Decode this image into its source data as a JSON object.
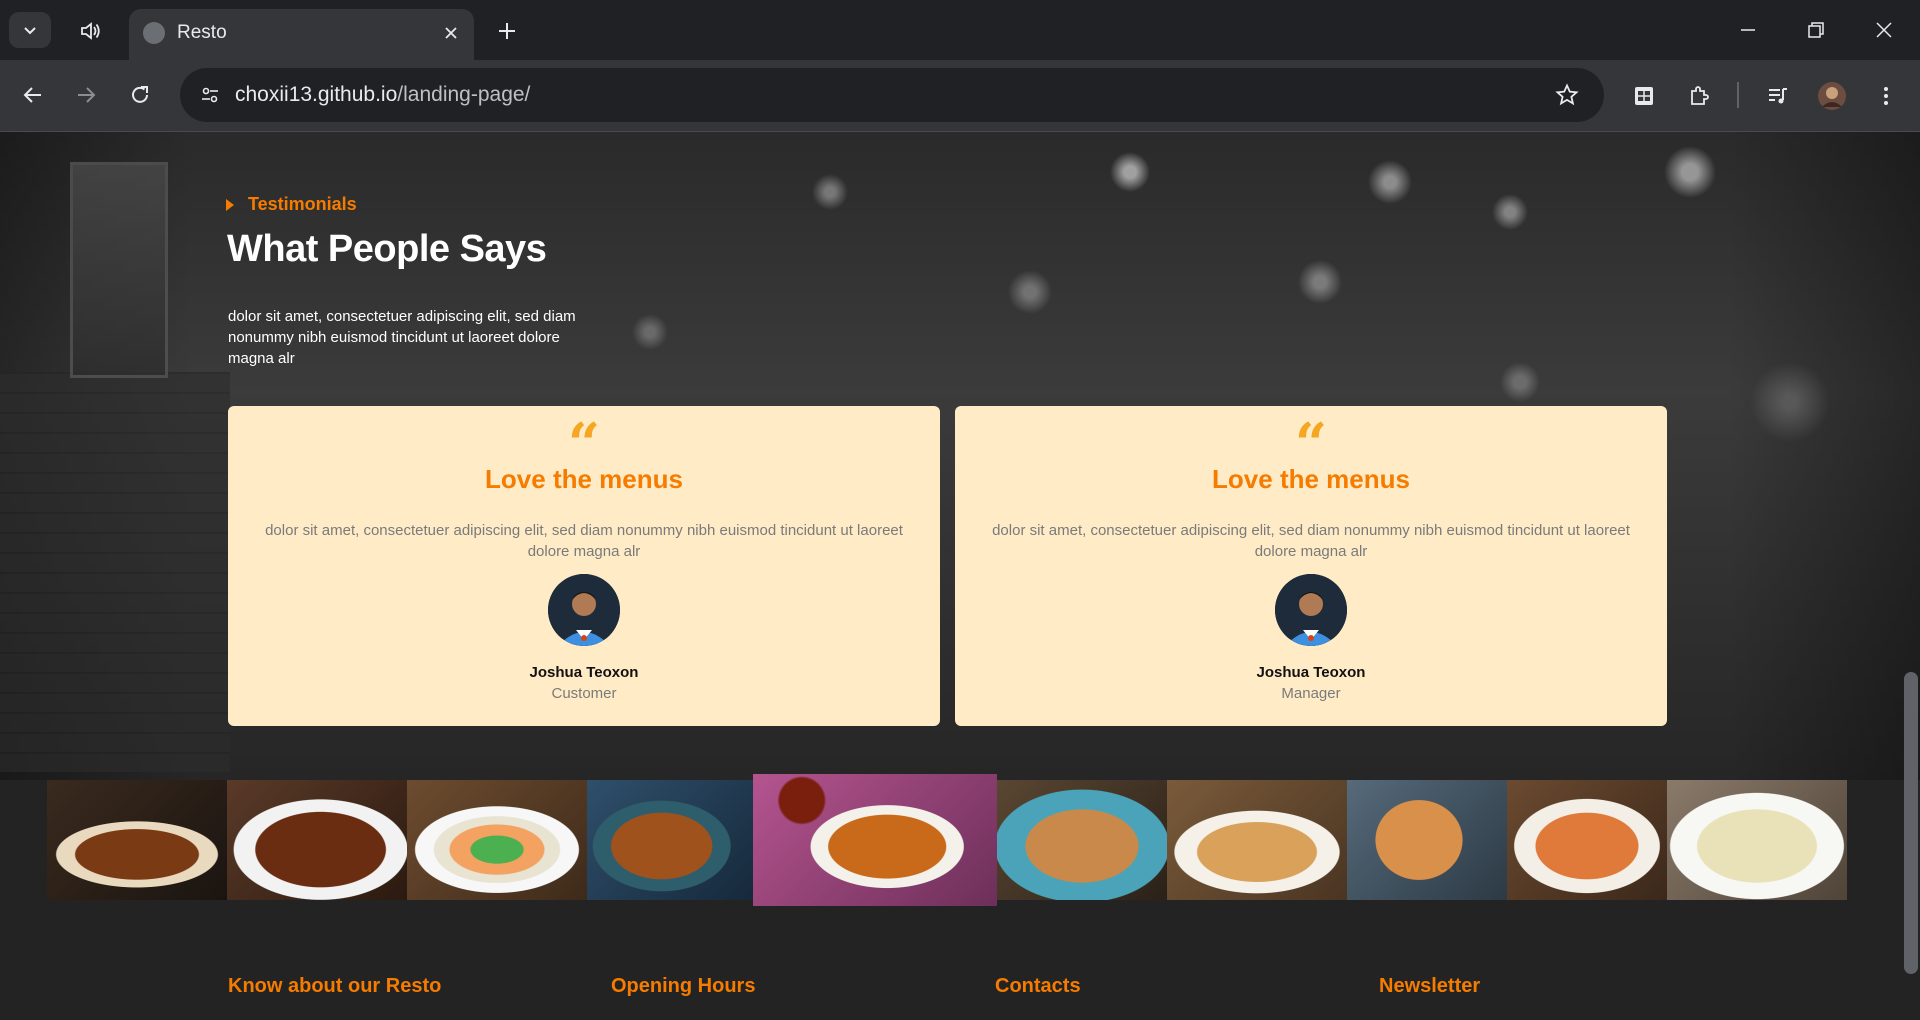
{
  "browser": {
    "tab_title": "Resto",
    "url_host": "choxii13.github.io",
    "url_path": "/landing-page/"
  },
  "testimonials": {
    "eyebrow": "Testimonials",
    "heading": "What People Says",
    "intro": "dolor sit amet, consectetuer adipiscing elit, sed diam nonummy nibh euismod tincidunt ut laoreet dolore magna alr",
    "quote_mark": "“",
    "cards": [
      {
        "title": "Love the menus",
        "text": "dolor sit amet, consectetuer adipiscing elit, sed diam nonummy nibh euismod tincidunt ut laoreet dolore magna alr",
        "name": "Joshua Teoxon",
        "role": "Customer"
      },
      {
        "title": "Love the menus",
        "text": "dolor sit amet, consectetuer adipiscing elit, sed diam nonummy nibh euismod tincidunt ut laoreet dolore magna alr",
        "name": "Joshua Teoxon",
        "role": "Manager"
      }
    ]
  },
  "footer": {
    "columns": [
      "Know about our Resto",
      "Opening Hours",
      "Contacts",
      "Newsletter"
    ]
  },
  "colors": {
    "accent": "#f57c00",
    "card_bg": "#ffecc7",
    "quote": "#f5a623"
  }
}
